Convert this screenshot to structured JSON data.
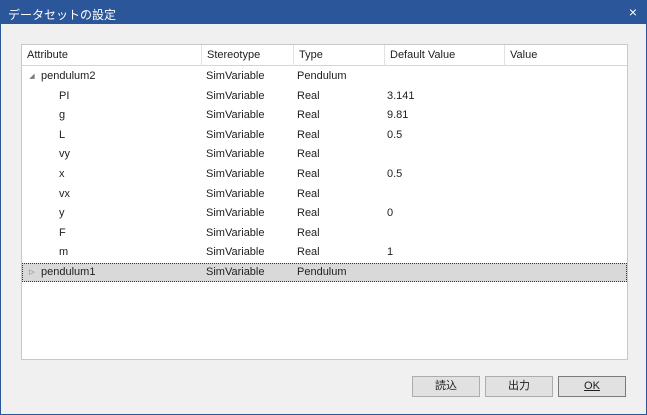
{
  "window": {
    "title": "データセットの設定",
    "close_glyph": "×"
  },
  "grid": {
    "columns": [
      "Attribute",
      "Stereotype",
      "Type",
      "Default Value",
      "Value"
    ],
    "rows": [
      {
        "attribute": "pendulum2",
        "stereotype": "SimVariable",
        "type": "Pendulum",
        "default": "",
        "value": "",
        "level": 0,
        "expander": "expanded"
      },
      {
        "attribute": "PI",
        "stereotype": "SimVariable",
        "type": "Real",
        "default": "3.141",
        "value": "",
        "level": 1
      },
      {
        "attribute": "g",
        "stereotype": "SimVariable",
        "type": "Real",
        "default": "9.81",
        "value": "",
        "level": 1
      },
      {
        "attribute": "L",
        "stereotype": "SimVariable",
        "type": "Real",
        "default": "0.5",
        "value": "",
        "level": 1
      },
      {
        "attribute": "vy",
        "stereotype": "SimVariable",
        "type": "Real",
        "default": "",
        "value": "",
        "level": 1
      },
      {
        "attribute": "x",
        "stereotype": "SimVariable",
        "type": "Real",
        "default": "0.5",
        "value": "",
        "level": 1
      },
      {
        "attribute": "vx",
        "stereotype": "SimVariable",
        "type": "Real",
        "default": "",
        "value": "",
        "level": 1
      },
      {
        "attribute": "y",
        "stereotype": "SimVariable",
        "type": "Real",
        "default": "0",
        "value": "",
        "level": 1
      },
      {
        "attribute": "F",
        "stereotype": "SimVariable",
        "type": "Real",
        "default": "",
        "value": "",
        "level": 1
      },
      {
        "attribute": "m",
        "stereotype": "SimVariable",
        "type": "Real",
        "default": "1",
        "value": "",
        "level": 1
      },
      {
        "attribute": "pendulum1",
        "stereotype": "SimVariable",
        "type": "Pendulum",
        "default": "",
        "value": "",
        "level": 0,
        "expander": "collapsed",
        "selected": true
      }
    ],
    "expander_icons": {
      "expanded": "◢",
      "collapsed": "▷"
    }
  },
  "buttons": {
    "load": "読込",
    "output": "出力",
    "ok": "OK"
  },
  "colors": {
    "titlebar": "#2b579a",
    "selected_row": "#d9d9d9"
  }
}
